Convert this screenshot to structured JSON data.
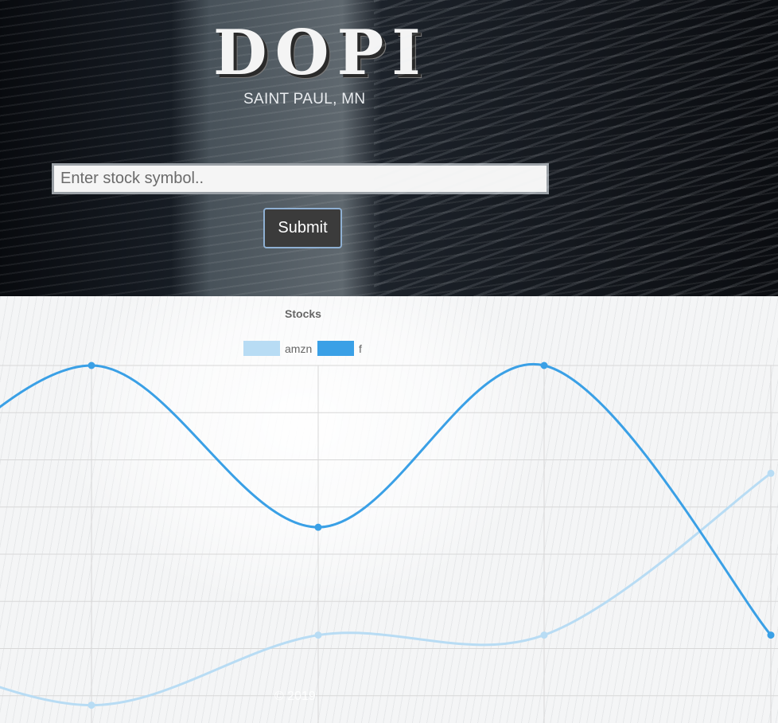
{
  "header": {
    "logo": "DOPI",
    "city": "SAINT PAUL, MN"
  },
  "search": {
    "placeholder": "Enter stock symbol..",
    "value": ""
  },
  "form": {
    "submit_label": "Submit"
  },
  "footer": {
    "text": "© 2019"
  },
  "colors": {
    "amzn": "#b8dcf4",
    "f": "#3aa0e6",
    "grid": "#d8d8d8"
  },
  "chart_data": {
    "type": "line",
    "title": "Stocks",
    "legend": "top",
    "grid": true,
    "series": [
      {
        "name": "amzn",
        "values": [
          0.7,
          2.0,
          2.0,
          5.0
        ]
      },
      {
        "name": "f",
        "values": [
          7.0,
          4.0,
          7.0,
          2.0
        ]
      }
    ],
    "ylim": [
      0,
      7
    ]
  }
}
